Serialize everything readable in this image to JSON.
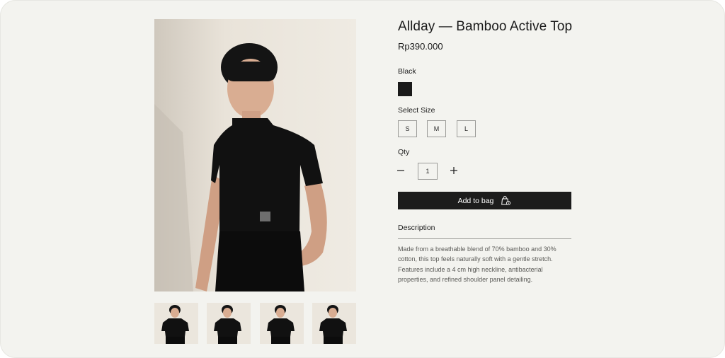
{
  "product": {
    "title": "Allday — Bamboo Active Top",
    "price": "Rp390.000"
  },
  "color": {
    "label": "Black",
    "swatch_hex": "#1a1a1a"
  },
  "size": {
    "label": "Select Size",
    "options": [
      "S",
      "M",
      "L"
    ]
  },
  "quantity": {
    "label": "Qty",
    "value": "1",
    "minus_icon": "minus-icon",
    "plus_icon": "plus-icon"
  },
  "cart": {
    "button_label": "Add to bag",
    "icon": "shopping-bag-icon"
  },
  "description": {
    "heading": "Description",
    "text": "Made from a breathable blend of 70% bamboo and 30% cotton, this top feels naturally soft with a gentle stretch. Features include a 4 cm high neckline, antibacterial properties, and refined shoulder panel detailing."
  },
  "gallery": {
    "thumbnail_count": 4
  }
}
